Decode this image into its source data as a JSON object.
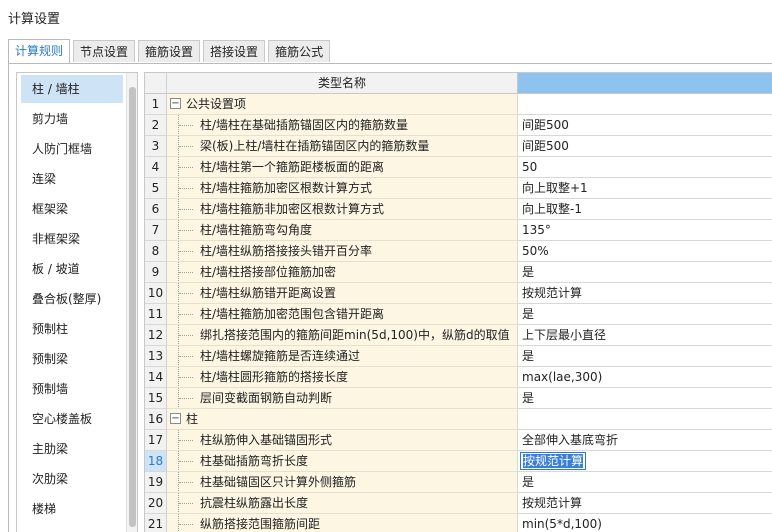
{
  "window": {
    "title": "计算设置"
  },
  "tabs": [
    {
      "label": "计算规则",
      "active": true
    },
    {
      "label": "节点设置",
      "active": false
    },
    {
      "label": "箍筋设置",
      "active": false
    },
    {
      "label": "搭接设置",
      "active": false
    },
    {
      "label": "箍筋公式",
      "active": false
    }
  ],
  "sidebar": {
    "items": [
      {
        "label": "柱 / 墙柱",
        "selected": true
      },
      {
        "label": "剪力墙"
      },
      {
        "label": "人防门框墙"
      },
      {
        "label": "连梁"
      },
      {
        "label": "框架梁"
      },
      {
        "label": "非框架梁"
      },
      {
        "label": "板 / 坡道"
      },
      {
        "label": "叠合板(整厚)"
      },
      {
        "label": "预制柱"
      },
      {
        "label": "预制梁"
      },
      {
        "label": "预制墙"
      },
      {
        "label": "空心楼盖板"
      },
      {
        "label": "主肋梁"
      },
      {
        "label": "次肋梁"
      },
      {
        "label": "楼梯"
      }
    ]
  },
  "grid": {
    "header": {
      "name": "类型名称",
      "value": ""
    },
    "rows": [
      {
        "num": "1",
        "name": "公共设置项",
        "value": "",
        "group": true,
        "toggle": "−"
      },
      {
        "num": "2",
        "name": "柱/墙柱在基础插筋锚固区内的箍筋数量",
        "value": "间距500"
      },
      {
        "num": "3",
        "name": "梁(板)上柱/墙柱在插筋锚固区内的箍筋数量",
        "value": "间距500"
      },
      {
        "num": "4",
        "name": "柱/墙柱第一个箍筋距楼板面的距离",
        "value": "50"
      },
      {
        "num": "5",
        "name": "柱/墙柱箍筋加密区根数计算方式",
        "value": "向上取整+1"
      },
      {
        "num": "6",
        "name": "柱/墙柱箍筋非加密区根数计算方式",
        "value": "向上取整-1"
      },
      {
        "num": "7",
        "name": "柱/墙柱箍筋弯勾角度",
        "value": "135°"
      },
      {
        "num": "8",
        "name": "柱/墙柱纵筋搭接接头错开百分率",
        "value": "50%"
      },
      {
        "num": "9",
        "name": "柱/墙柱搭接部位箍筋加密",
        "value": "是"
      },
      {
        "num": "10",
        "name": "柱/墙柱纵筋错开距离设置",
        "value": "按规范计算"
      },
      {
        "num": "11",
        "name": "柱/墙柱箍筋加密范围包含错开距离",
        "value": "是"
      },
      {
        "num": "12",
        "name": "绑扎搭接范围内的箍筋间距min(5d,100)中，纵筋d的取值",
        "value": "上下层最小直径"
      },
      {
        "num": "13",
        "name": "柱/墙柱螺旋箍筋是否连续通过",
        "value": "是"
      },
      {
        "num": "14",
        "name": "柱/墙柱圆形箍筋的搭接长度",
        "value": "max(lae,300)"
      },
      {
        "num": "15",
        "name": "层间变截面钢筋自动判断",
        "value": "是"
      },
      {
        "num": "16",
        "name": "柱",
        "value": "",
        "group": true,
        "toggle": "−"
      },
      {
        "num": "17",
        "name": "柱纵筋伸入基础锚固形式",
        "value": "全部伸入基底弯折"
      },
      {
        "num": "18",
        "name": "柱基础插筋弯折长度",
        "value": "按规范计算",
        "selected": true
      },
      {
        "num": "19",
        "name": "柱基础锚固区只计算外侧箍筋",
        "value": "是"
      },
      {
        "num": "20",
        "name": "抗震柱纵筋露出长度",
        "value": "按规范计算"
      },
      {
        "num": "21",
        "name": "纵筋搭接范围箍筋间距",
        "value": "min(5*d,100)"
      }
    ]
  },
  "colors": {
    "accent": "#2b78d0",
    "selection": "#cfe3f7",
    "name_cell_bg": "#fdf6e3",
    "header_value_bg": "#8ec3ef"
  }
}
